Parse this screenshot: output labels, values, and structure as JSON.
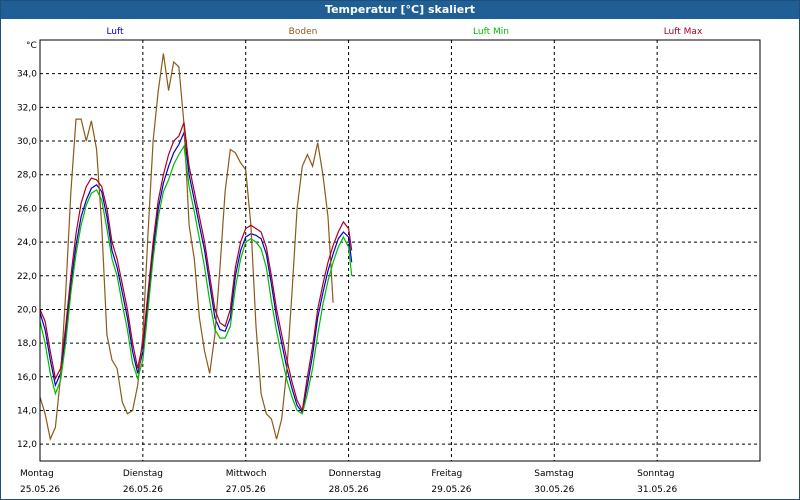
{
  "window": {
    "title": "Temperatur [°C] skaliert"
  },
  "chart_data": {
    "type": "line",
    "title": "Temperatur [°C] skaliert",
    "ylabel": "°C",
    "xlabel": "",
    "ylim": [
      11,
      36
    ],
    "yticks": [
      "12,0",
      "14,0",
      "16,0",
      "18,0",
      "20,0",
      "22,0",
      "24,0",
      "26,0",
      "28,0",
      "30,0",
      "32,0",
      "34,0"
    ],
    "ytick_values": [
      12,
      14,
      16,
      18,
      20,
      22,
      24,
      26,
      28,
      30,
      32,
      34
    ],
    "xlim": [
      0,
      7
    ],
    "x_days": [
      {
        "day": "Montag",
        "date": "25.05.26"
      },
      {
        "day": "Dienstag",
        "date": "26.05.26"
      },
      {
        "day": "Mittwoch",
        "date": "27.05.26"
      },
      {
        "day": "Donnerstag",
        "date": "28.05.26"
      },
      {
        "day": "Freitag",
        "date": "29.05.26"
      },
      {
        "day": "Samstag",
        "date": "30.05.26"
      },
      {
        "day": "Sonntag",
        "date": "31.05.26"
      }
    ],
    "grid": true,
    "legend_placement": "top",
    "series": [
      {
        "name": "Luft",
        "color": "#0000cc",
        "points": [
          [
            0,
            19.8
          ],
          [
            0.05,
            18.8
          ],
          [
            0.1,
            17
          ],
          [
            0.15,
            15.5
          ],
          [
            0.2,
            16.2
          ],
          [
            0.25,
            18.5
          ],
          [
            0.3,
            21.5
          ],
          [
            0.35,
            23.8
          ],
          [
            0.4,
            25.5
          ],
          [
            0.45,
            26.5
          ],
          [
            0.5,
            27.2
          ],
          [
            0.55,
            27.4
          ],
          [
            0.6,
            27.0
          ],
          [
            0.65,
            25.5
          ],
          [
            0.7,
            23.5
          ],
          [
            0.75,
            22.5
          ],
          [
            0.8,
            21.0
          ],
          [
            0.85,
            19.5
          ],
          [
            0.9,
            17.5
          ],
          [
            0.95,
            16.2
          ],
          [
            1.0,
            17.5
          ],
          [
            1.05,
            20.5
          ],
          [
            1.1,
            23.5
          ],
          [
            1.15,
            26.0
          ],
          [
            1.2,
            27.5
          ],
          [
            1.25,
            28.5
          ],
          [
            1.3,
            29.3
          ],
          [
            1.35,
            29.8
          ],
          [
            1.4,
            30.5
          ],
          [
            1.45,
            28.0
          ],
          [
            1.5,
            26.5
          ],
          [
            1.55,
            25.0
          ],
          [
            1.6,
            23.5
          ],
          [
            1.65,
            21.5
          ],
          [
            1.7,
            19.5
          ],
          [
            1.75,
            18.8
          ],
          [
            1.8,
            18.7
          ],
          [
            1.85,
            19.5
          ],
          [
            1.9,
            22.0
          ],
          [
            1.95,
            23.5
          ],
          [
            2.0,
            24.3
          ],
          [
            2.05,
            24.5
          ],
          [
            2.1,
            24.4
          ],
          [
            2.15,
            24.2
          ],
          [
            2.2,
            23.3
          ],
          [
            2.25,
            21.5
          ],
          [
            2.3,
            19.5
          ],
          [
            2.35,
            18.0
          ],
          [
            2.4,
            16.5
          ],
          [
            2.45,
            15.3
          ],
          [
            2.5,
            14.3
          ],
          [
            2.55,
            13.9
          ],
          [
            2.6,
            15.5
          ],
          [
            2.65,
            17.3
          ],
          [
            2.7,
            19.5
          ],
          [
            2.75,
            21.0
          ],
          [
            2.8,
            22.3
          ],
          [
            2.85,
            23.3
          ],
          [
            2.9,
            24.2
          ],
          [
            2.95,
            24.6
          ],
          [
            3.0,
            24.3
          ],
          [
            3.03,
            22.8
          ]
        ]
      },
      {
        "name": "Boden",
        "color": "#8b5a1a",
        "points": [
          [
            0,
            14.8
          ],
          [
            0.05,
            13.8
          ],
          [
            0.1,
            12.3
          ],
          [
            0.15,
            13.0
          ],
          [
            0.2,
            16.0
          ],
          [
            0.25,
            21.0
          ],
          [
            0.3,
            27.0
          ],
          [
            0.35,
            31.3
          ],
          [
            0.4,
            31.3
          ],
          [
            0.45,
            30.0
          ],
          [
            0.5,
            31.2
          ],
          [
            0.55,
            29.5
          ],
          [
            0.6,
            25.0
          ],
          [
            0.65,
            18.5
          ],
          [
            0.7,
            17.0
          ],
          [
            0.75,
            16.5
          ],
          [
            0.8,
            14.5
          ],
          [
            0.85,
            13.8
          ],
          [
            0.9,
            14.0
          ],
          [
            0.95,
            15.5
          ],
          [
            1.0,
            18.5
          ],
          [
            1.05,
            24.5
          ],
          [
            1.1,
            30.0
          ],
          [
            1.15,
            33.0
          ],
          [
            1.2,
            35.2
          ],
          [
            1.25,
            33.0
          ],
          [
            1.3,
            34.7
          ],
          [
            1.35,
            34.4
          ],
          [
            1.4,
            31.0
          ],
          [
            1.45,
            25.0
          ],
          [
            1.5,
            23.0
          ],
          [
            1.55,
            19.5
          ],
          [
            1.6,
            17.5
          ],
          [
            1.65,
            16.2
          ],
          [
            1.7,
            18.5
          ],
          [
            1.75,
            22.5
          ],
          [
            1.8,
            27.0
          ],
          [
            1.85,
            29.5
          ],
          [
            1.9,
            29.3
          ],
          [
            1.95,
            28.7
          ],
          [
            2.0,
            28.3
          ],
          [
            2.05,
            25.0
          ],
          [
            2.1,
            19.0
          ],
          [
            2.15,
            15.0
          ],
          [
            2.2,
            13.8
          ],
          [
            2.25,
            13.5
          ],
          [
            2.3,
            12.3
          ],
          [
            2.35,
            13.5
          ],
          [
            2.4,
            16.5
          ],
          [
            2.45,
            21.0
          ],
          [
            2.5,
            26.0
          ],
          [
            2.55,
            28.5
          ],
          [
            2.6,
            29.2
          ],
          [
            2.65,
            28.5
          ],
          [
            2.7,
            29.9
          ],
          [
            2.75,
            28.0
          ],
          [
            2.8,
            25.5
          ],
          [
            2.85,
            20.4
          ]
        ]
      },
      {
        "name": "Luft Min",
        "color": "#00bb00",
        "points": [
          [
            0,
            19.3
          ],
          [
            0.05,
            18.0
          ],
          [
            0.1,
            16.2
          ],
          [
            0.15,
            15.0
          ],
          [
            0.2,
            15.8
          ],
          [
            0.25,
            18.0
          ],
          [
            0.3,
            21.0
          ],
          [
            0.35,
            23.3
          ],
          [
            0.4,
            25.0
          ],
          [
            0.45,
            26.2
          ],
          [
            0.5,
            26.9
          ],
          [
            0.55,
            27.1
          ],
          [
            0.6,
            26.5
          ],
          [
            0.65,
            24.8
          ],
          [
            0.7,
            23.0
          ],
          [
            0.75,
            22.0
          ],
          [
            0.8,
            20.3
          ],
          [
            0.85,
            18.8
          ],
          [
            0.9,
            16.8
          ],
          [
            0.95,
            15.9
          ],
          [
            1.0,
            17.0
          ],
          [
            1.05,
            20.0
          ],
          [
            1.1,
            23.0
          ],
          [
            1.15,
            25.5
          ],
          [
            1.2,
            27.0
          ],
          [
            1.25,
            27.7
          ],
          [
            1.3,
            28.6
          ],
          [
            1.35,
            29.2
          ],
          [
            1.4,
            29.7
          ],
          [
            1.45,
            27.3
          ],
          [
            1.5,
            25.8
          ],
          [
            1.55,
            24.2
          ],
          [
            1.6,
            22.5
          ],
          [
            1.65,
            20.5
          ],
          [
            1.7,
            18.8
          ],
          [
            1.75,
            18.3
          ],
          [
            1.8,
            18.3
          ],
          [
            1.85,
            19.0
          ],
          [
            1.9,
            21.3
          ],
          [
            1.95,
            23.0
          ],
          [
            2.0,
            24.0
          ],
          [
            2.05,
            24.2
          ],
          [
            2.1,
            24.0
          ],
          [
            2.15,
            23.6
          ],
          [
            2.2,
            22.5
          ],
          [
            2.25,
            20.5
          ],
          [
            2.3,
            18.7
          ],
          [
            2.35,
            17.2
          ],
          [
            2.4,
            15.8
          ],
          [
            2.45,
            14.8
          ],
          [
            2.5,
            14.0
          ],
          [
            2.55,
            13.8
          ],
          [
            2.6,
            15.0
          ],
          [
            2.65,
            16.5
          ],
          [
            2.7,
            18.5
          ],
          [
            2.75,
            20.3
          ],
          [
            2.8,
            21.7
          ],
          [
            2.85,
            22.8
          ],
          [
            2.9,
            23.7
          ],
          [
            2.95,
            24.3
          ],
          [
            3.0,
            23.7
          ],
          [
            3.03,
            22.0
          ]
        ]
      },
      {
        "name": "Luft Max",
        "color": "#aa0022",
        "points": [
          [
            0,
            20.0
          ],
          [
            0.05,
            19.3
          ],
          [
            0.1,
            17.5
          ],
          [
            0.15,
            15.9
          ],
          [
            0.2,
            16.5
          ],
          [
            0.25,
            19.0
          ],
          [
            0.3,
            22.0
          ],
          [
            0.35,
            24.5
          ],
          [
            0.4,
            26.3
          ],
          [
            0.45,
            27.3
          ],
          [
            0.5,
            27.8
          ],
          [
            0.55,
            27.7
          ],
          [
            0.6,
            27.3
          ],
          [
            0.65,
            26.0
          ],
          [
            0.7,
            24.0
          ],
          [
            0.75,
            23.0
          ],
          [
            0.8,
            21.5
          ],
          [
            0.85,
            20.0
          ],
          [
            0.9,
            18.0
          ],
          [
            0.95,
            16.5
          ],
          [
            1.0,
            18.0
          ],
          [
            1.05,
            21.0
          ],
          [
            1.1,
            24.0
          ],
          [
            1.15,
            26.5
          ],
          [
            1.2,
            28.0
          ],
          [
            1.25,
            29.2
          ],
          [
            1.3,
            30.0
          ],
          [
            1.35,
            30.3
          ],
          [
            1.4,
            31.1
          ],
          [
            1.45,
            28.5
          ],
          [
            1.5,
            27.0
          ],
          [
            1.55,
            25.5
          ],
          [
            1.6,
            24.0
          ],
          [
            1.65,
            22.0
          ],
          [
            1.7,
            20.0
          ],
          [
            1.75,
            19.2
          ],
          [
            1.8,
            19.0
          ],
          [
            1.85,
            20.0
          ],
          [
            1.9,
            22.5
          ],
          [
            1.95,
            24.0
          ],
          [
            2.0,
            24.8
          ],
          [
            2.05,
            25.0
          ],
          [
            2.1,
            24.8
          ],
          [
            2.15,
            24.6
          ],
          [
            2.2,
            23.7
          ],
          [
            2.25,
            22.0
          ],
          [
            2.3,
            20.0
          ],
          [
            2.35,
            18.5
          ],
          [
            2.4,
            17.0
          ],
          [
            2.45,
            15.7
          ],
          [
            2.5,
            14.6
          ],
          [
            2.55,
            14.0
          ],
          [
            2.6,
            16.0
          ],
          [
            2.65,
            17.8
          ],
          [
            2.7,
            20.0
          ],
          [
            2.75,
            21.5
          ],
          [
            2.8,
            22.8
          ],
          [
            2.85,
            23.8
          ],
          [
            2.9,
            24.6
          ],
          [
            2.95,
            25.2
          ],
          [
            3.0,
            24.8
          ],
          [
            3.03,
            23.5
          ]
        ]
      }
    ]
  }
}
